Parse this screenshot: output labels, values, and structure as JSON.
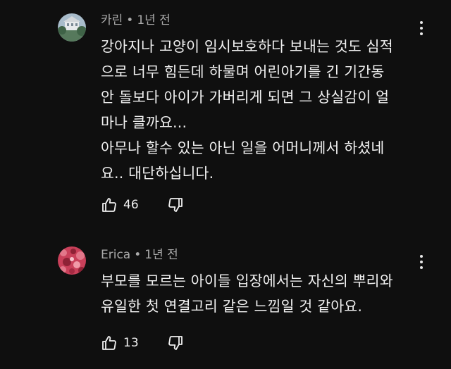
{
  "comments": [
    {
      "author": "카린",
      "separator": "•",
      "time": "1년 전",
      "text": "강아지나 고양이 임시보호하다 보내는 것도 심적\n으로 너무 힘든데 하물며 어린아기를 긴 기간동\n안 돌보다 아이가 가버리게 되면 그 상실감이 얼\n마나 클까요...\n아무나 할수 있는 아닌 일을 어머니께서 하셨네\n요.. 대단하십니다.",
      "likes": "46",
      "avatar_colors": [
        "#9fb4c4",
        "#5d7f62",
        "#e9ecef"
      ]
    },
    {
      "author": "Erica",
      "separator": "•",
      "time": "1년 전",
      "text": "부모를 모르는 아이들 입장에서는 자신의 뿌리와\n유일한 첫 연결고리 같은 느낌일 것 같아요.",
      "likes": "13",
      "avatar_colors": [
        "#c9405a",
        "#e2778a",
        "#8e2236"
      ]
    }
  ],
  "icons": {
    "like": "thumbs-up-outline",
    "dislike": "thumbs-down-outline",
    "menu": "vertical-ellipsis"
  },
  "colors": {
    "background": "#0f0f0f",
    "text": "#f1f1f1",
    "meta": "#aaaaaa"
  }
}
